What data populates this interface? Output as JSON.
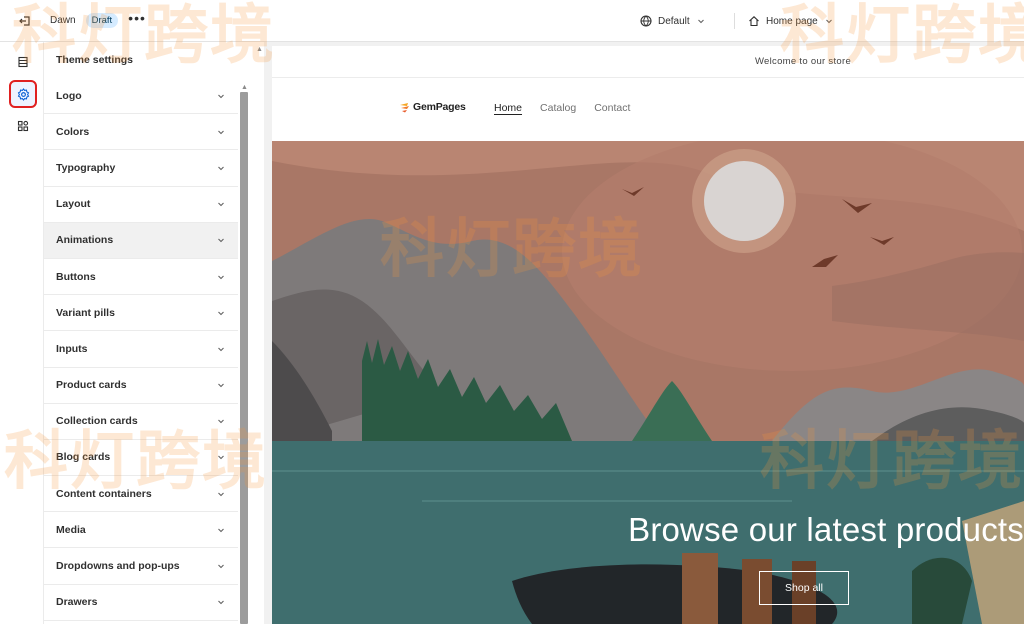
{
  "topbar": {
    "theme_name": "Dawn",
    "status_badge": "Draft",
    "more_label": "•••",
    "viewport_label": "Default",
    "page_label": "Home page"
  },
  "rail": {
    "icons": [
      "sections-icon",
      "gear-icon",
      "apps-icon"
    ],
    "active": "gear-icon"
  },
  "panel": {
    "title": "Theme settings",
    "items": [
      {
        "label": "Logo"
      },
      {
        "label": "Colors"
      },
      {
        "label": "Typography"
      },
      {
        "label": "Layout"
      },
      {
        "label": "Animations"
      },
      {
        "label": "Buttons"
      },
      {
        "label": "Variant pills"
      },
      {
        "label": "Inputs"
      },
      {
        "label": "Product cards"
      },
      {
        "label": "Collection cards"
      },
      {
        "label": "Blog cards"
      },
      {
        "label": "Content containers"
      },
      {
        "label": "Media"
      },
      {
        "label": "Dropdowns and pop-ups"
      },
      {
        "label": "Drawers"
      }
    ]
  },
  "preview": {
    "announcement": "Welcome to our store",
    "logo_text": "GemPages",
    "nav": [
      "Home",
      "Catalog",
      "Contact"
    ],
    "hero_title": "Browse our latest products",
    "hero_button": "Shop all"
  },
  "watermark": {
    "text": "科灯跨境"
  },
  "colors": {
    "accent": "#005bd3",
    "badge_bg": "#d5ebff",
    "highlight_border": "#e02020",
    "sky": "#a57463",
    "water": "#3f6e6e"
  }
}
